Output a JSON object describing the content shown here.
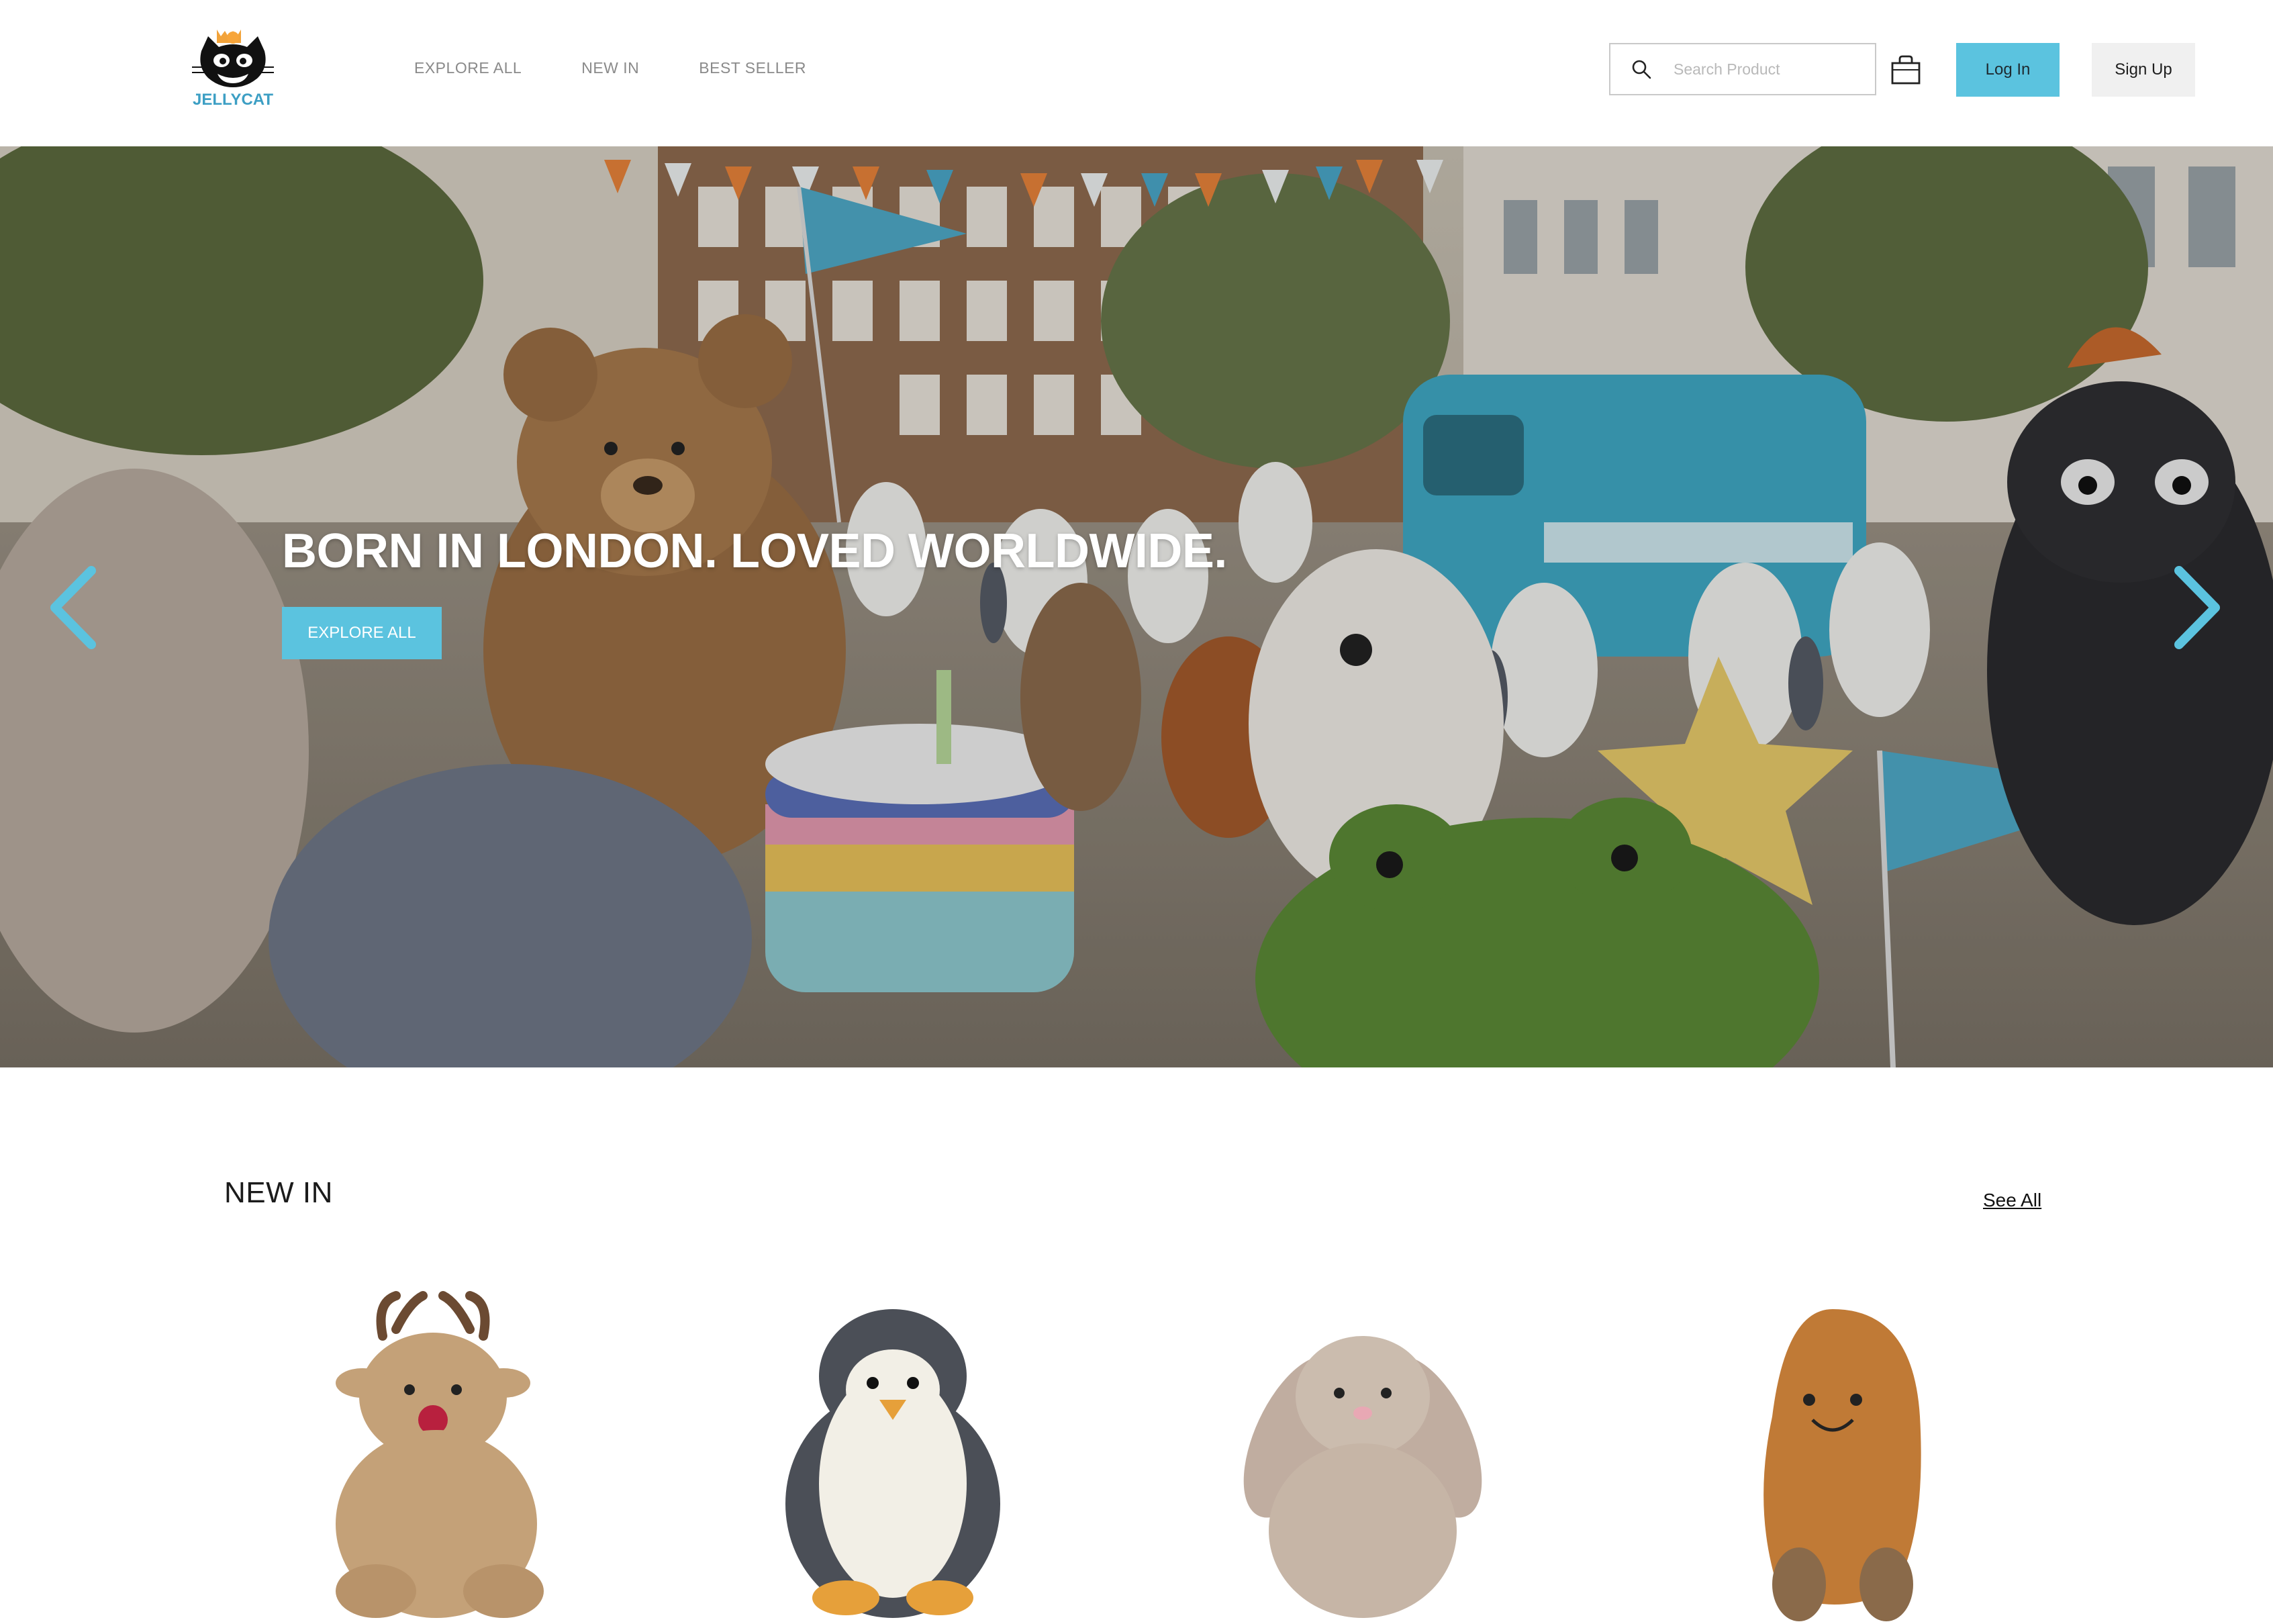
{
  "brand": {
    "name": "JELLYCAT",
    "logo_icon": "cat-logo-icon",
    "accent": "#5bc3df"
  },
  "nav": {
    "items": [
      {
        "label": "EXPLORE ALL"
      },
      {
        "label": "NEW IN"
      },
      {
        "label": "BEST SELLER"
      }
    ]
  },
  "search": {
    "placeholder": "Search Product",
    "icon": "search-icon"
  },
  "cart": {
    "icon": "shopping-bag-icon"
  },
  "auth": {
    "login_label": "Log In",
    "signup_label": "Sign Up"
  },
  "hero": {
    "title": "BORN IN LONDON. LOVED WORLDWIDE.",
    "cta_label": "EXPLORE ALL",
    "prev_icon": "chevron-left-icon",
    "next_icon": "chevron-right-icon",
    "slides_total": 4,
    "active_slide": 1
  },
  "new_in": {
    "title": "NEW IN",
    "see_all_label": "See All",
    "products": [
      {
        "image": "reindeer-plush"
      },
      {
        "image": "penguin-plush"
      },
      {
        "image": "bunny-plush"
      },
      {
        "image": "bean-plush"
      }
    ]
  }
}
